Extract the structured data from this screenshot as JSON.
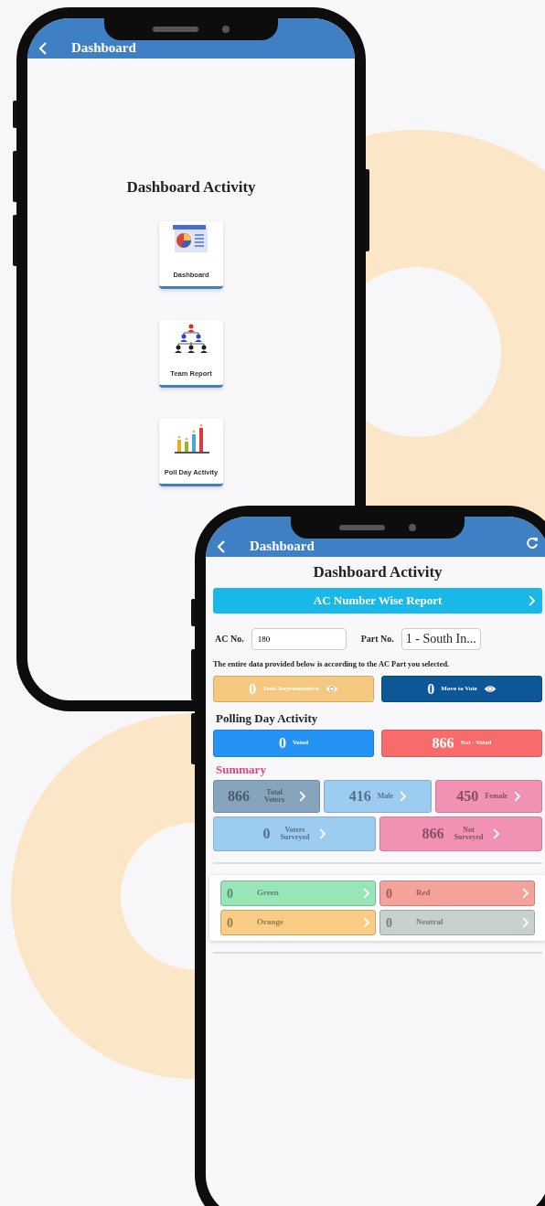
{
  "phone_1": {
    "header": {
      "title": "Dashboard",
      "refresh": false
    },
    "heading": "Dashboard Activity",
    "tiles": [
      {
        "label": "Dashboard",
        "kind": "dashboard"
      },
      {
        "label": "Team Report",
        "kind": "team"
      },
      {
        "label": "Poll Day Activity",
        "kind": "poll"
      }
    ]
  },
  "phone_2": {
    "header": {
      "title": "Dashboard",
      "refresh": true
    },
    "heading": "Dashboard Activity",
    "report_button": "AC Number Wise Report",
    "ac_no": {
      "label": "AC No.",
      "value": "180"
    },
    "part_no": {
      "label": "Part No.",
      "value": "1 - South In..."
    },
    "note": "The entire data provided below is according to the AC Part you selected.",
    "stats": [
      {
        "value": "0",
        "label": "Total Representative",
        "color": "#f5c880",
        "kind": "solid"
      },
      {
        "value": "0",
        "label": "Move to Vote",
        "color": "#0d5797",
        "kind": "solid"
      }
    ],
    "polling_heading": "Polling Day Activity",
    "polling": [
      {
        "value": "0",
        "label": "Voted",
        "color": "#2493f5",
        "kind": "solid"
      },
      {
        "value": "866",
        "label": "Not - Voted",
        "color": "#f76b6b",
        "kind": "solid"
      }
    ],
    "summary_heading": "Summary",
    "summary_rows": [
      [
        {
          "value": "866",
          "label": "Total Voters",
          "color": "#86a5bd",
          "kind": "tint"
        },
        {
          "value": "416",
          "label": "Male",
          "color": "#9ccdf0",
          "kind": "tint"
        },
        {
          "value": "450",
          "label": "Female",
          "color": "#f191b4",
          "kind": "tint"
        }
      ],
      [
        {
          "value": "0",
          "label": "Voters Surveyed",
          "color": "#9ccdf0",
          "kind": "tint"
        },
        {
          "value": "866",
          "label": "Not Surveyed",
          "color": "#f191b4",
          "kind": "tint"
        }
      ]
    ],
    "categories": [
      {
        "value": "0",
        "label": "Green",
        "color": "#98e6b8"
      },
      {
        "value": "0",
        "label": "Red",
        "color": "#f4a29a"
      },
      {
        "value": "0",
        "label": "Orange",
        "color": "#f9cd85"
      },
      {
        "value": "0",
        "label": "Neutral",
        "color": "#c8d0d0"
      }
    ]
  }
}
